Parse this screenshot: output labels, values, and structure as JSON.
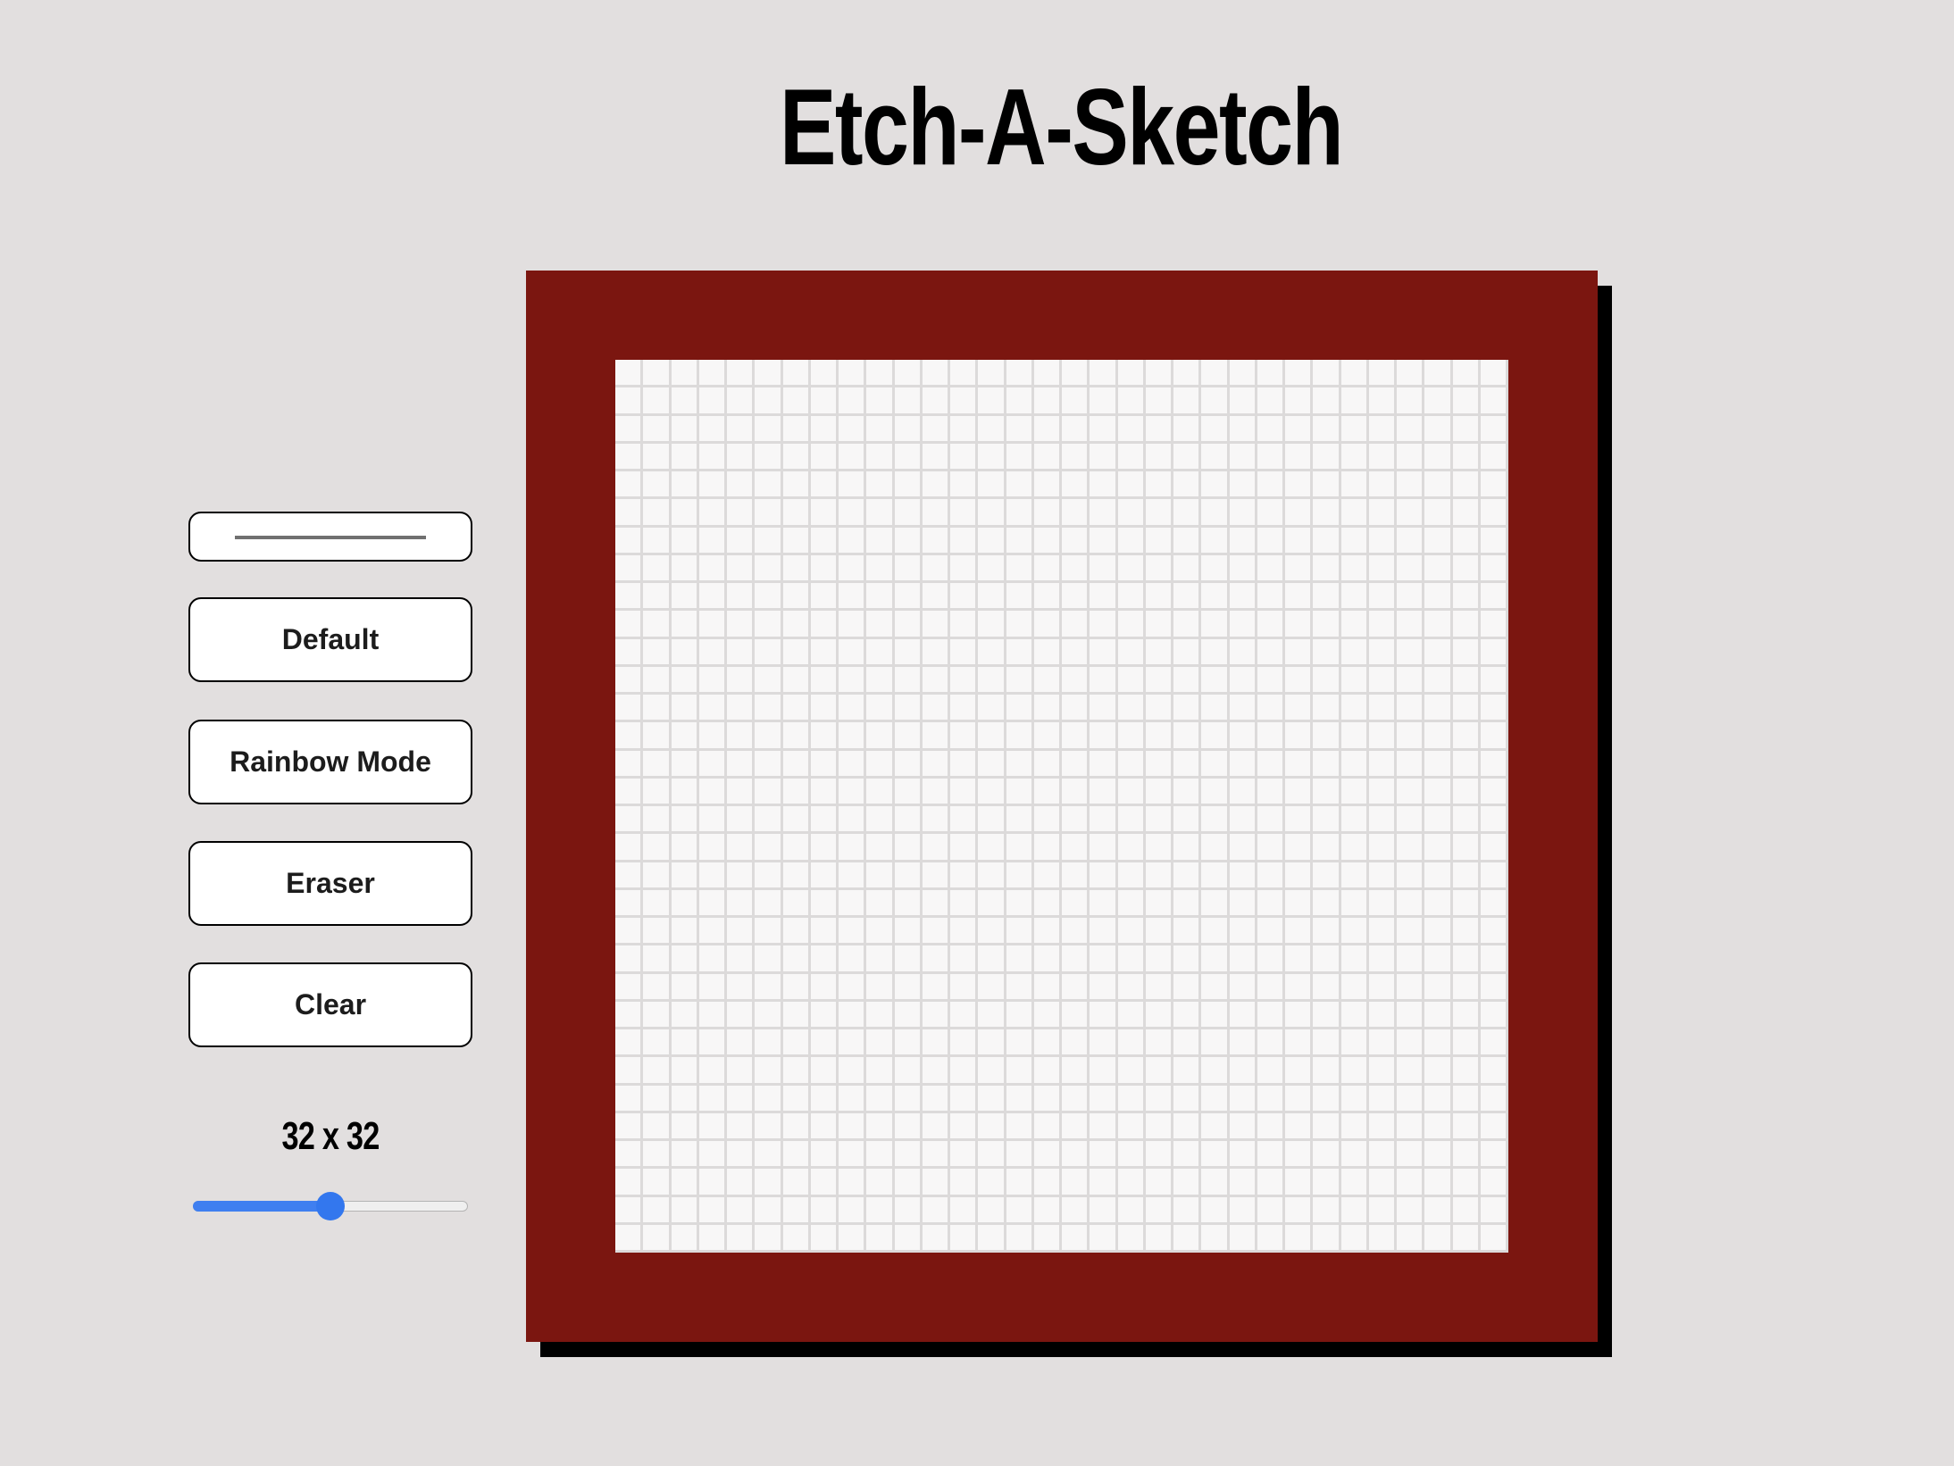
{
  "header": {
    "title": "Etch-A-Sketch"
  },
  "controls": {
    "color_picker": {
      "value": "#707070"
    },
    "buttons": {
      "default_label": "Default",
      "rainbow_label": "Rainbow Mode",
      "eraser_label": "Eraser",
      "clear_label": "Clear"
    },
    "size": {
      "label": "32 x 32",
      "value": 32,
      "min": 1,
      "max": 64,
      "fraction": 0.5
    }
  },
  "board": {
    "rows": 32,
    "columns": 32,
    "frame_color": "#7b1610",
    "cell_color": "#f8f7f7",
    "grid_line_color": "#dcdada"
  }
}
